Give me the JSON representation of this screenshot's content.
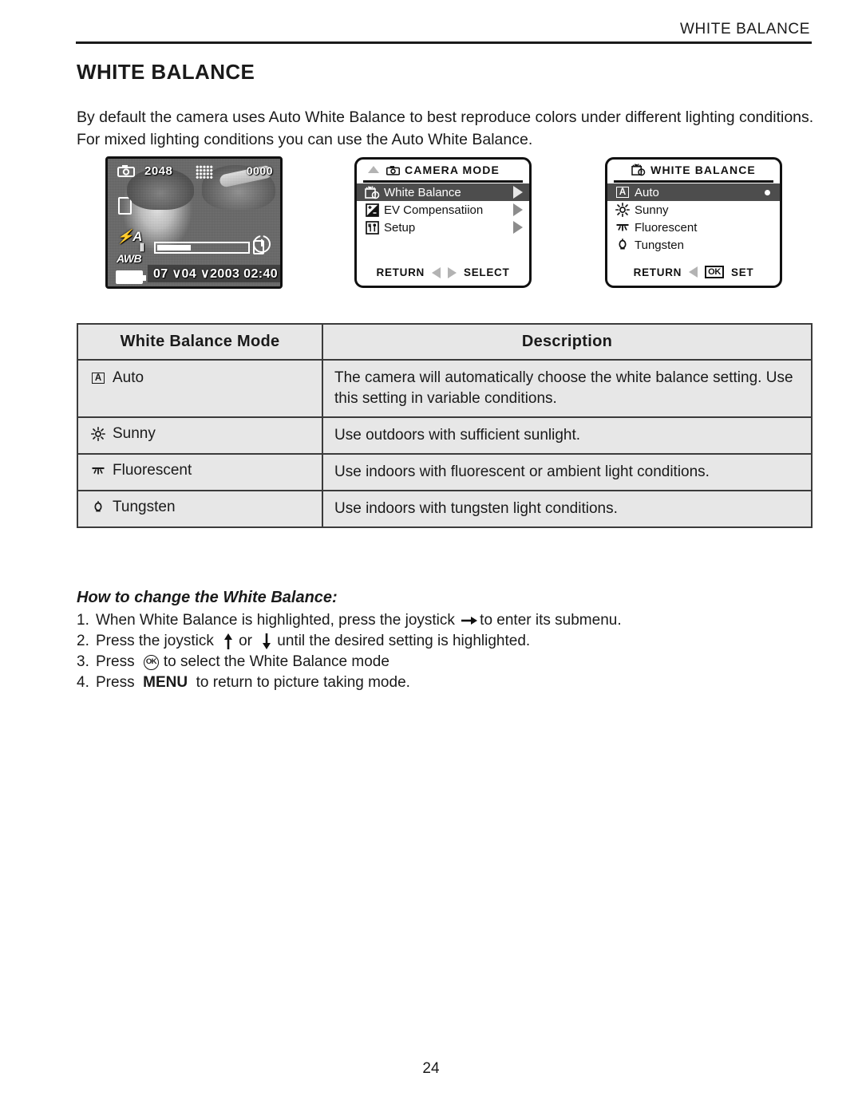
{
  "header": {
    "running_head": "WHITE BALANCE"
  },
  "title": "WHITE BALANCE",
  "intro": "By default the camera uses Auto White Balance to best reproduce colors under different lighting conditions. For mixed lighting conditions you can use the Auto White Balance.",
  "figures": {
    "preview": {
      "resolution": "2048",
      "frame_counter": "0000",
      "flash_mode": "A",
      "white_balance_indicator": "AWB",
      "datetime": "07 ∨04 ∨2003  02:40",
      "icons": {
        "camera": "camera-icon",
        "quality_grid": "quality-grid-icon",
        "memory_card": "memory-card-icon",
        "flash_auto": "flash-auto-icon",
        "battery": "battery-icon",
        "self_timer": "self-timer-icon",
        "wide": "zoom-wide-icon",
        "tele": "zoom-tele-icon"
      }
    },
    "camera_mode_menu": {
      "title": "CAMERA MODE",
      "items": [
        {
          "label": "White Balance",
          "icon": "white-balance-icon",
          "selected": true
        },
        {
          "label": "EV Compensatiion",
          "icon": "ev-compensation-icon",
          "selected": false
        },
        {
          "label": "Setup",
          "icon": "setup-icon",
          "selected": false
        }
      ],
      "footer": {
        "left": "RETURN",
        "right": "SELECT"
      }
    },
    "white_balance_menu": {
      "title": "WHITE BALANCE",
      "items": [
        {
          "label": "Auto",
          "icon": "auto-a-icon",
          "selected": true,
          "checked": true
        },
        {
          "label": "Sunny",
          "icon": "sunny-icon",
          "selected": false,
          "checked": false
        },
        {
          "label": "Fluorescent",
          "icon": "fluorescent-icon",
          "selected": false,
          "checked": false
        },
        {
          "label": "Tungsten",
          "icon": "tungsten-icon",
          "selected": false,
          "checked": false
        }
      ],
      "footer": {
        "left": "RETURN",
        "ok_badge": "OK",
        "right": "SET"
      }
    }
  },
  "table": {
    "headers": [
      "White Balance Mode",
      "Description"
    ],
    "rows": [
      {
        "icon": "auto-a-icon",
        "mode": "Auto",
        "description": "The camera will automatically choose the white balance setting.  Use this setting in variable conditions."
      },
      {
        "icon": "sunny-icon",
        "mode": "Sunny",
        "description": "Use outdoors with sufficient sunlight."
      },
      {
        "icon": "fluorescent-icon",
        "mode": "Fluorescent",
        "description": "Use indoors with fluorescent or ambient light conditions."
      },
      {
        "icon": "tungsten-icon",
        "mode": "Tungsten",
        "description": "Use indoors with tungsten light conditions."
      }
    ]
  },
  "howto": {
    "title": "How to change the White Balance:",
    "steps": [
      {
        "num": "1.",
        "before": "When White Balance is highlighted, press the joystick",
        "icon": "arrow-right-icon",
        "after": "to enter its submenu."
      },
      {
        "num": "2.",
        "before": "Press the joystick",
        "icon": "arrow-up-icon",
        "mid": "or",
        "icon2": "arrow-down-icon",
        "after": "until the desired setting is highlighted."
      },
      {
        "num": "3.",
        "before": "Press",
        "icon": "ok-button-icon",
        "after": "to select the White Balance mode"
      },
      {
        "num": "4.",
        "before": "Press",
        "kbd": "MENU",
        "after": "to return to picture taking mode."
      }
    ]
  },
  "page_number": "24"
}
